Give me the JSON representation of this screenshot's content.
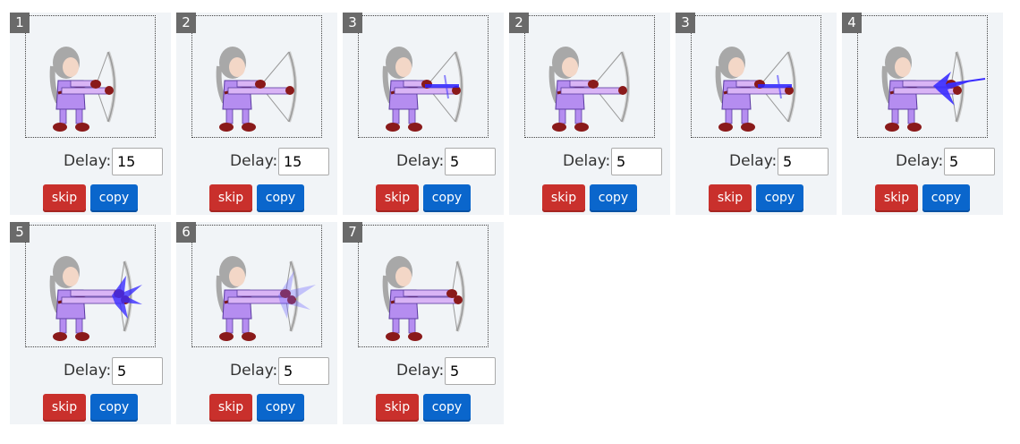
{
  "labels": {
    "delay": "Delay:",
    "skip": "skip",
    "copy": "copy"
  },
  "colors": {
    "panel_background": "#f1f4f7",
    "badge_background": "#6a6a6a",
    "skip_button": "#c9302c",
    "copy_button": "#0a66cc",
    "arrow_flash": "#3a2dff"
  },
  "icons": {
    "sprite": "archer-sprite-icon"
  },
  "frames": [
    {
      "badge": "1",
      "delay": "15",
      "pose": "aim",
      "effect": "none"
    },
    {
      "badge": "2",
      "delay": "15",
      "pose": "draw",
      "effect": "none"
    },
    {
      "badge": "3",
      "delay": "5",
      "pose": "draw",
      "effect": "arrow-charge"
    },
    {
      "badge": "2",
      "delay": "5",
      "pose": "draw",
      "effect": "none"
    },
    {
      "badge": "3",
      "delay": "5",
      "pose": "draw",
      "effect": "arrow-charge"
    },
    {
      "badge": "4",
      "delay": "5",
      "pose": "release",
      "effect": "arrow-flash"
    },
    {
      "badge": "5",
      "delay": "5",
      "pose": "release",
      "effect": "burst"
    },
    {
      "badge": "6",
      "delay": "5",
      "pose": "release",
      "effect": "burst-fade"
    },
    {
      "badge": "7",
      "delay": "5",
      "pose": "release",
      "effect": "none"
    }
  ]
}
